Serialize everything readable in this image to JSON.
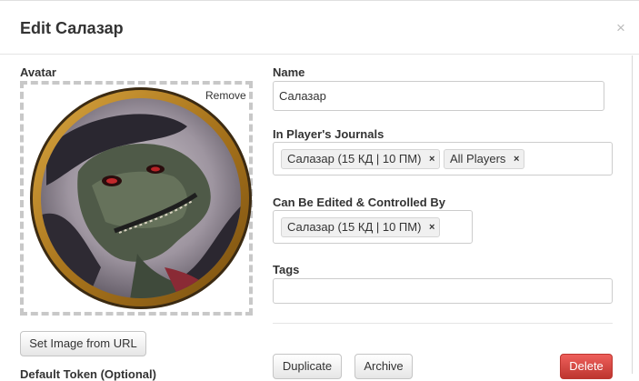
{
  "dialog": {
    "title": "Edit Салазар",
    "close_glyph": "×"
  },
  "avatar": {
    "label": "Avatar",
    "remove_label": "Remove",
    "set_url_label": "Set Image from URL",
    "next_section_label": "Default Token (Optional)"
  },
  "name_field": {
    "label": "Name",
    "value": "Салазар"
  },
  "journals": {
    "label": "In Player's Journals",
    "chips": [
      "Салазар (15 КД | 10 ПМ)",
      "All Players"
    ]
  },
  "controlled_by": {
    "label": "Can Be Edited & Controlled By",
    "chips": [
      "Салазар (15 КД | 10 ПМ)"
    ]
  },
  "tags": {
    "label": "Tags",
    "value": ""
  },
  "actions": {
    "duplicate_label": "Duplicate",
    "archive_label": "Archive",
    "delete_label": "Delete"
  },
  "colors": {
    "delete_button": "#da4f49",
    "portrait_frame": "#b5831f"
  },
  "chip_remove_glyph": "×"
}
